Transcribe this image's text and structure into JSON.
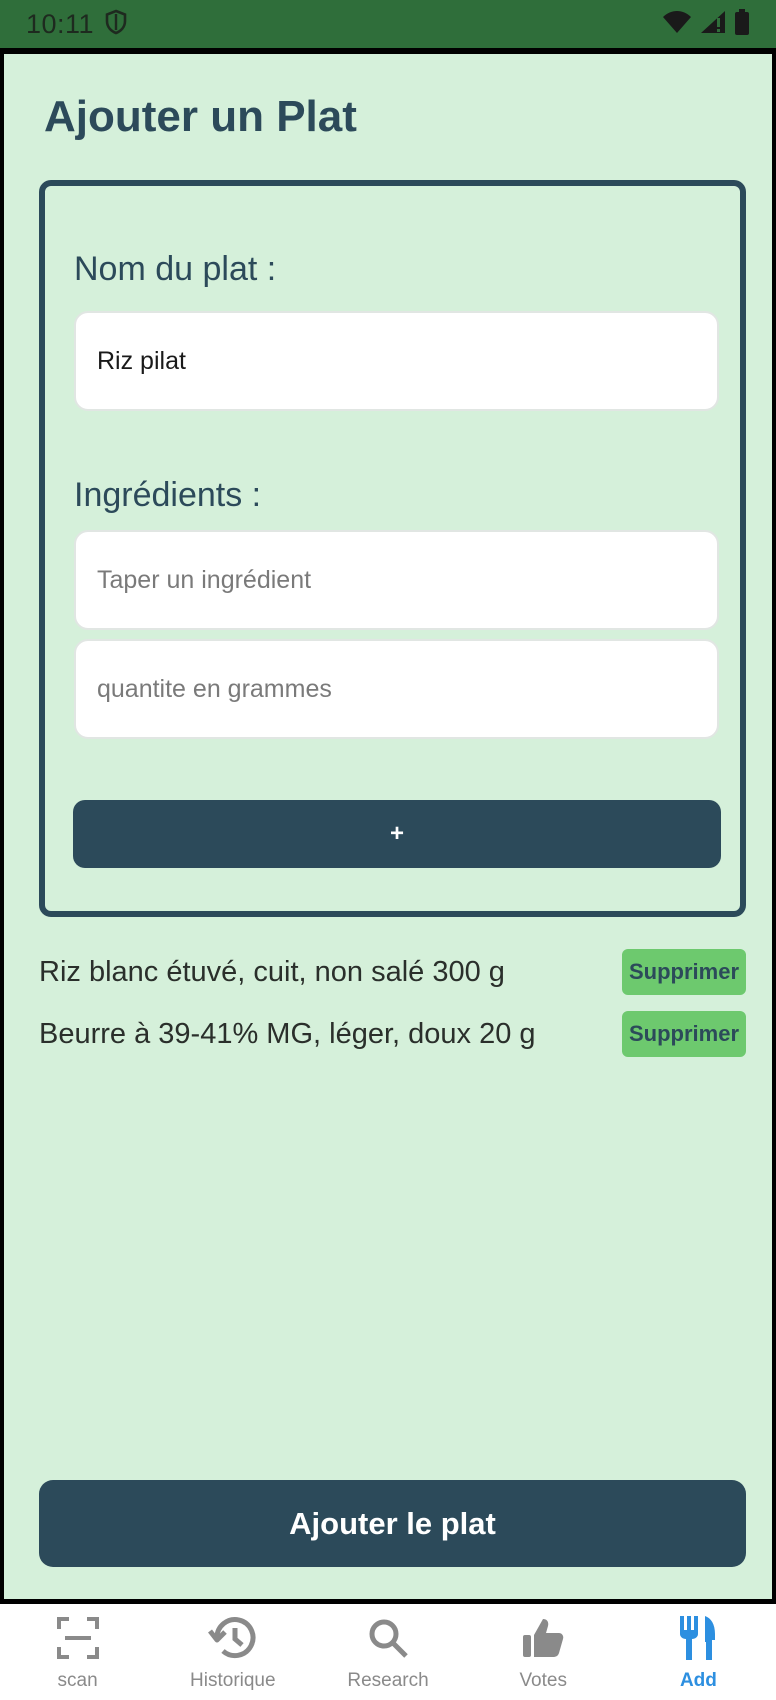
{
  "status_bar": {
    "time": "10:11",
    "icons": [
      "shield-icon",
      "wifi-icon",
      "signal-icon",
      "battery-icon"
    ]
  },
  "page": {
    "title": "Ajouter un Plat"
  },
  "form": {
    "dish_name_label": "Nom du plat :",
    "dish_name_value": "Riz pilat",
    "ingredients_label": "Ingrédients :",
    "ingredient_placeholder": "Taper un ingrédient",
    "quantity_placeholder": "quantite en grammes",
    "add_ingredient_label": "+"
  },
  "ingredients": [
    {
      "text": "Riz blanc étuvé, cuit, non salé 300 g",
      "delete_label": "Supprimer"
    },
    {
      "text": "Beurre à 39-41% MG, léger, doux 20 g",
      "delete_label": "Supprimer"
    }
  ],
  "submit_label": "Ajouter le plat",
  "bottom_nav": {
    "items": [
      {
        "label": "scan",
        "icon": "scan-icon",
        "active": false
      },
      {
        "label": "Historique",
        "icon": "history-icon",
        "active": false
      },
      {
        "label": "Research",
        "icon": "search-icon",
        "active": false
      },
      {
        "label": "Votes",
        "icon": "thumbs-up-icon",
        "active": false
      },
      {
        "label": "Add",
        "icon": "fork-knife-icon",
        "active": true
      }
    ]
  },
  "colors": {
    "status_bar": "#2f6e3a",
    "background": "#d5f0da",
    "primary": "#2c4a5a",
    "delete_button": "#6dc96e",
    "nav_active": "#2d8fe0",
    "nav_inactive": "#8a8a8a"
  }
}
